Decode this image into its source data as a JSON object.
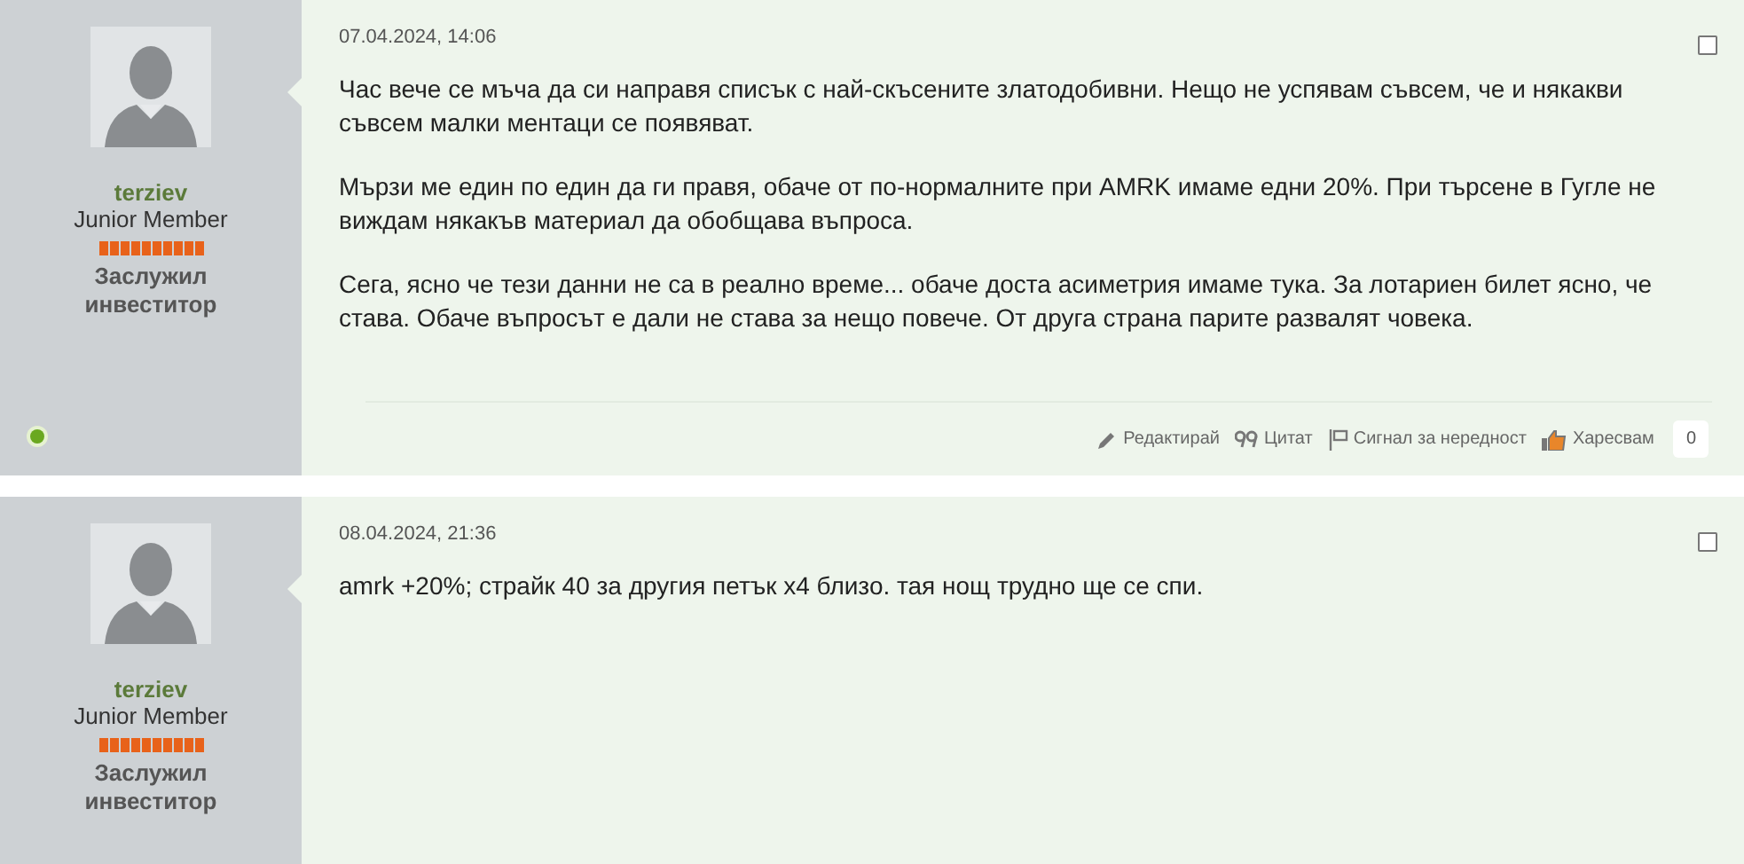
{
  "posts": [
    {
      "author": {
        "username": "terziev",
        "rank": "Junior Member",
        "title": "Заслужил инвеститор",
        "online": true
      },
      "date": "07.04.2024, 14:06",
      "checked": false,
      "paragraphs": [
        "Час вече се мъча да си направя списък с най-скъсените златодобивни. Нещо не успявам съвсем, че и някакви съвсем малки ментаци се появяват.",
        "Мързи ме един по един да ги правя, обаче от по-нормалните при AMRK имаме едни 20%. При търсене в Гугле не виждам някакъв материал да обобщава въпроса.",
        "Сега, ясно че тези данни не са в реално време... обаче доста асиметрия имаме тука. За лотариен билет ясно, че става. Обаче въпросът е дали не става за нещо повече. От друга страна парите развалят човека."
      ],
      "actions": [
        {
          "kind": "edit",
          "label": "Редактирай"
        },
        {
          "kind": "quote",
          "label": "Цитат"
        },
        {
          "kind": "report",
          "label": "Сигнал за нередност"
        },
        {
          "kind": "like",
          "label": "Харесвам"
        }
      ],
      "like_count": "0"
    },
    {
      "author": {
        "username": "terziev",
        "rank": "Junior Member",
        "title": "Заслужил инвеститор",
        "online": false
      },
      "date": "08.04.2024, 21:36",
      "checked": false,
      "paragraphs": [
        "amrk +20%; страйк 40 за другия петък x4 близо. тая нощ трудно ще се спи."
      ]
    }
  ]
}
